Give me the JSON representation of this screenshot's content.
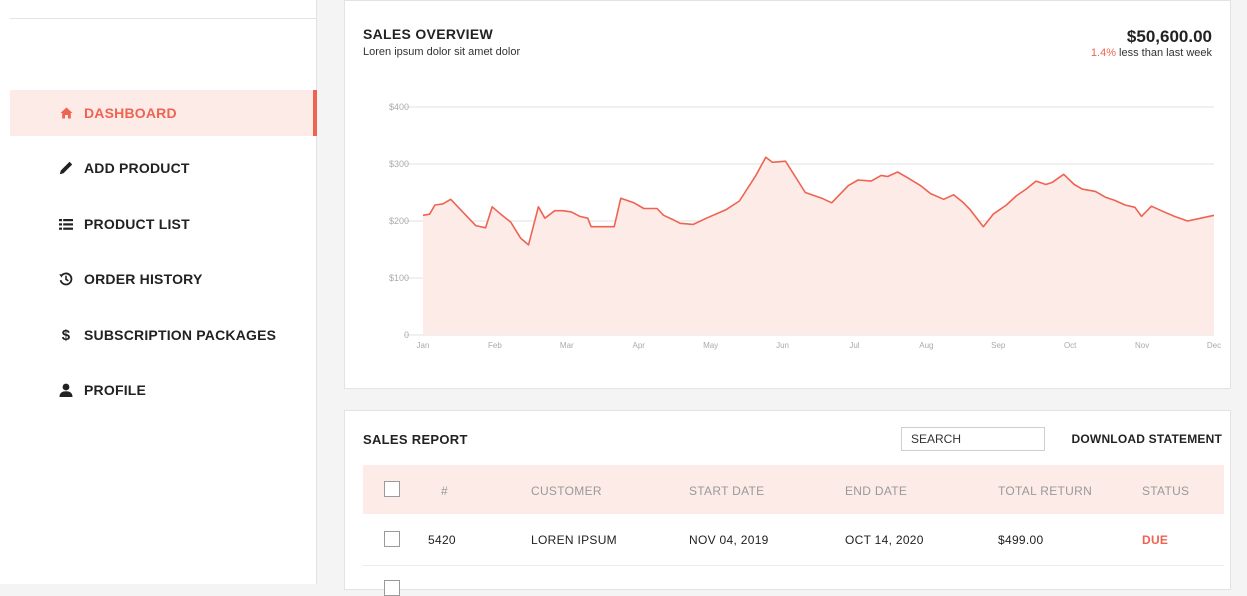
{
  "sidebar": {
    "items": [
      {
        "label": "DASHBOARD",
        "icon": "home-icon",
        "active": true
      },
      {
        "label": "ADD PRODUCT",
        "icon": "pencil-icon",
        "active": false
      },
      {
        "label": "PRODUCT LIST",
        "icon": "list-icon",
        "active": false
      },
      {
        "label": "ORDER HISTORY",
        "icon": "history-icon",
        "active": false
      },
      {
        "label": "SUBSCRIPTION PACKAGES",
        "icon": "dollar-icon",
        "active": false
      },
      {
        "label": "PROFILE",
        "icon": "user-icon",
        "active": false
      }
    ]
  },
  "overview": {
    "title": "SALES OVERVIEW",
    "subtitle": "Loren ipsum dolor sit amet dolor",
    "total": "$50,600.00",
    "change_pct": "1.4%",
    "change_text": " less than last week"
  },
  "chart_data": {
    "type": "area",
    "x_labels": [
      "Jan",
      "Feb",
      "Mar",
      "Apr",
      "May",
      "Jun",
      "Jul",
      "Aug",
      "Sep",
      "Oct",
      "Nov",
      "Dec"
    ],
    "y_ticks": [
      "0",
      "$100",
      "$200",
      "$300",
      "$400"
    ],
    "ylim": [
      0,
      400
    ],
    "x": [
      0,
      0.1,
      0.18,
      0.3,
      0.42,
      0.8,
      0.95,
      1.05,
      1.18,
      1.33,
      1.48,
      1.6,
      1.75,
      1.85,
      2.0,
      2.12,
      2.25,
      2.38,
      2.5,
      2.55,
      2.75,
      2.9,
      3.0,
      3.2,
      3.35,
      3.55,
      3.65,
      3.8,
      3.9,
      4.1,
      4.3,
      4.6,
      4.8,
      5.05,
      5.2,
      5.3,
      5.5,
      5.8,
      6.05,
      6.2,
      6.45,
      6.6,
      6.8,
      6.95,
      7.05,
      7.2,
      7.35,
      7.55,
      7.7,
      7.9,
      8.05,
      8.2,
      8.3,
      8.5,
      8.65,
      8.85,
      9.0,
      9.15,
      9.3,
      9.45,
      9.55,
      9.72,
      9.88,
      10.0,
      10.2,
      10.35,
      10.5,
      10.65,
      10.8,
      10.9,
      11.05,
      11.2,
      11.4,
      11.6,
      11.8,
      12.0
    ],
    "series": [
      {
        "values": [
          210,
          212,
          228,
          230,
          238,
          192,
          188,
          225,
          212,
          198,
          170,
          158,
          225,
          205,
          218,
          218,
          216,
          208,
          205,
          190,
          190,
          190,
          240,
          232,
          222,
          222,
          210,
          202,
          196,
          194,
          205,
          220,
          235,
          280,
          312,
          303,
          305,
          250,
          240,
          232,
          262,
          272,
          270,
          280,
          278,
          286,
          276,
          262,
          248,
          238,
          246,
          232,
          220,
          190,
          212,
          228,
          244,
          256,
          270,
          264,
          268,
          282,
          264,
          256,
          252,
          242,
          236,
          228,
          224,
          208,
          226,
          218,
          208,
          200,
          205,
          210
        ]
      }
    ],
    "colors": {
      "line": "#ee6352",
      "fill": "#fdebe8"
    },
    "grid": true
  },
  "report": {
    "title": "SALES REPORT",
    "search_placeholder": "SEARCH",
    "download_label": "DOWNLOAD STATEMENT",
    "columns": [
      "#",
      "CUSTOMER",
      "START DATE",
      "END DATE",
      "TOTAL RETURN",
      "STATUS"
    ],
    "rows": [
      {
        "id": "5420",
        "customer": "LOREN IPSUM",
        "start": "NOV 04, 2019",
        "end": "OCT 14, 2020",
        "total": "$499.00",
        "status": "DUE"
      }
    ]
  },
  "colors": {
    "accent": "#ee6352",
    "accent_light": "#fdebe8"
  }
}
